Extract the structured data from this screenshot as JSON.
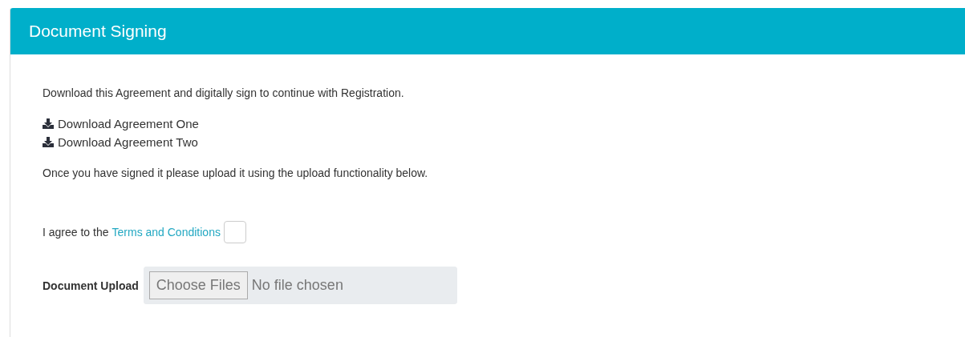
{
  "panel": {
    "title": "Document Signing"
  },
  "intro": "Download this Agreement and digitally sign to continue with Registration.",
  "downloads": [
    {
      "label": "Download Agreement One"
    },
    {
      "label": "Download Agreement Two"
    }
  ],
  "note": "Once you have signed it please upload it using the upload functionality below.",
  "agreement": {
    "prefix": "I agree to the",
    "link": "Terms and Conditions",
    "checked": false
  },
  "upload": {
    "label": "Document Upload",
    "button": "Choose Files",
    "status": "No file chosen",
    "disabled": true
  }
}
